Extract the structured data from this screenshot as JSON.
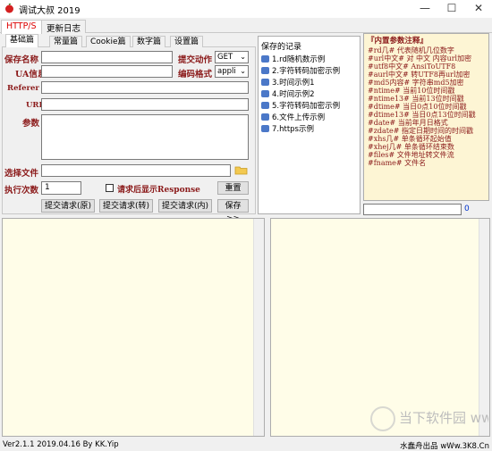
{
  "window": {
    "title": "调试大叔 2019"
  },
  "outer_tabs": [
    "HTTP/S",
    "更新日志"
  ],
  "inner_tabs": [
    "基础篇",
    "常量篇",
    "Cookie篇",
    "数字篇",
    "设置篇"
  ],
  "form": {
    "save_name_label": "保存名称",
    "submit_action_label": "提交动作",
    "submit_action_value": "GET",
    "ua_label": "UA信息",
    "encoding_label": "编码格式",
    "encoding_value": "appli",
    "referer_label": "Referer",
    "url_label": "URL",
    "params_label": "参数",
    "file_label": "选择文件",
    "exec_count_label": "执行次数",
    "exec_count_value": "1",
    "checkbox_label": "请求后显示Response",
    "reset_button": "重置"
  },
  "actions": [
    "提交请求(原)",
    "提交请求(转)",
    "提交请求(内)",
    "保存>>"
  ],
  "saved": {
    "header": "保存的记录",
    "items": [
      "1.rd随机数示例",
      "2.字符转码加密示例",
      "3.时间示例1",
      "4.时间示例2",
      "5.字符转码加密示例",
      "6.文件上传示例",
      "7.https示例"
    ]
  },
  "builtin_params": {
    "header": "『内置参数注释』",
    "rows": [
      [
        "#rd几#",
        "代表随机几位数字"
      ],
      [
        "#url中文#",
        "对 中文 内容url加密"
      ],
      [
        "#utf8中文#",
        "AnsiToUTF8"
      ],
      [
        "#aurl中文#",
        "转UTF8再url加密"
      ],
      [
        "#md5内容#",
        "字符串md5加密"
      ],
      [
        "#ntime#",
        "当前10位时间戳"
      ],
      [
        "#ntime13#",
        "当前13位时间戳"
      ],
      [
        "#dtime#",
        "当日0点10位时间戳"
      ],
      [
        "#dtime13#",
        "当日0点13位时间戳"
      ],
      [
        "#date#",
        "当前年月日格式"
      ],
      [
        "#zdate#",
        "指定日期时间的时间戳"
      ],
      [
        "#xhs几#",
        "单条循环起始值"
      ],
      [
        "#xhej几#",
        "单条循环结束数"
      ],
      [
        "#files#",
        "文件地址转文件流"
      ],
      [
        "#fname#",
        "文件名"
      ]
    ],
    "counter_value": "0"
  },
  "status": {
    "left": "Ver2.1.1 2019.04.16 By KK.Yip",
    "right": "水蠢舟出品 wWw.3K8.Cn"
  },
  "watermark": "当下软件园 www.downxia.com"
}
